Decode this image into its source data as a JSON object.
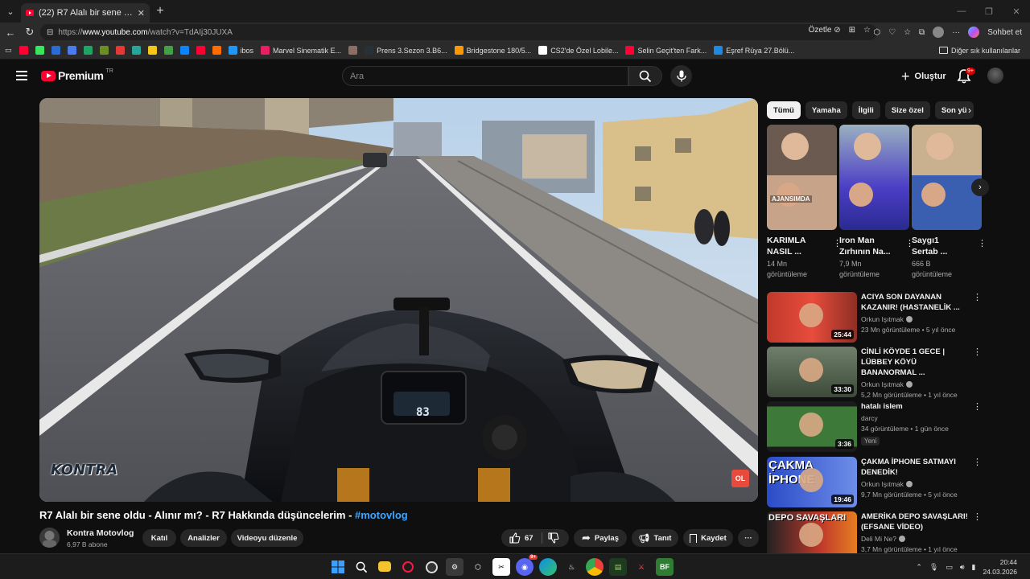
{
  "browser": {
    "tab_title": "(22) R7 Alalı bir sene oldu - Alınır m",
    "url_prefix": "https://",
    "url_host": "www.youtube.com",
    "url_path": "/watch?v=TdAIj30JUXA",
    "summarize_label": "Özetle",
    "chat_label": "Sohbet et"
  },
  "bookmarks": [
    {
      "label": "",
      "color": "#ff0033"
    },
    {
      "label": "",
      "color": "#39e75f"
    },
    {
      "label": "",
      "color": "#2a6bd6"
    },
    {
      "label": "",
      "color": "#4b7bec"
    },
    {
      "label": "",
      "color": "#1fa463"
    },
    {
      "label": "",
      "color": "#6b8e23"
    },
    {
      "label": "",
      "color": "#e53935"
    },
    {
      "label": "",
      "color": "#26a69a"
    },
    {
      "label": "",
      "color": "#f5c518"
    },
    {
      "label": "",
      "color": "#43a047"
    },
    {
      "label": "",
      "color": "#0a84ff"
    },
    {
      "label": "",
      "color": "#ff0033"
    },
    {
      "label": "",
      "color": "#ff6d00"
    },
    {
      "label": "ibos",
      "color": "#2196f3"
    },
    {
      "label": "Marvel Sinematik E...",
      "color": "#e91e63"
    },
    {
      "label": "",
      "color": "#8d6e63"
    },
    {
      "label": "Prens 3.Sezon 3.B6...",
      "color": "#263238"
    },
    {
      "label": "Bridgestone 180/5...",
      "color": "#ff9800"
    },
    {
      "label": "CS2'de Özel Lobile...",
      "color": "#ffffff"
    },
    {
      "label": "Selin Geçit'ten Fark...",
      "color": "#ff0033"
    },
    {
      "label": "Eşref Rüya 27.Bölü...",
      "color": "#1e88e5"
    }
  ],
  "bookmarks_more": "Diğer sık kullanılanlar",
  "youtube": {
    "logo_text": "Premium",
    "logo_region": "TR",
    "search_placeholder": "Ara",
    "create_label": "Oluştur",
    "notif_count": "9+"
  },
  "video": {
    "title": "R7 Alalı bir sene oldu - Alınır mı? - R7 Hakkında düşüncelerim - ",
    "hashtag": "#motovlog",
    "channel_name": "Kontra Motovlog",
    "subscribers": "6,97 B abone",
    "join_label": "Katıl",
    "analytics_label": "Analizler",
    "edit_label": "Videoyu düzenle",
    "likes": "67",
    "share_label": "Paylaş",
    "promote_label": "Tanıt",
    "save_label": "Kaydet",
    "watermark_left": "KONTRA",
    "watermark_right": "OL"
  },
  "chips": [
    "Tümü",
    "Yamaha",
    "İlgili",
    "Size özel",
    "Son yü"
  ],
  "shorts": [
    {
      "title_l1": "KARIMLA",
      "title_l2": "NASIL ...",
      "views_l1": "14 Mn",
      "views_l2": "görüntüleme",
      "overlay": "AJANSIMDA"
    },
    {
      "title_l1": "Iron Man",
      "title_l2": "Zırhının Na...",
      "views_l1": "7,9 Mn",
      "views_l2": "görüntüleme",
      "overlay": ""
    },
    {
      "title_l1": "Saygı1",
      "title_l2": "Sertab ...",
      "views_l1": "666 B",
      "views_l2": "görüntüleme",
      "overlay": ""
    }
  ],
  "recommendations": [
    {
      "title": "ACIYA SON DAYANAN KAZANIR! (HASTANELİK ...",
      "channel": "Orkun Işıtmak",
      "verified": true,
      "meta": "23 Mn görüntüleme • 5 yıl önce",
      "duration": "25:44",
      "badge": ""
    },
    {
      "title": "CİNLİ KÖYDE 1 GECE | LÜBBEY KÖYÜ BANANORMAL ...",
      "channel": "Orkun Işıtmak",
      "verified": true,
      "meta": "5,2 Mn görüntüleme • 1 yıl önce",
      "duration": "33:30",
      "badge": ""
    },
    {
      "title": "hatalı islem",
      "channel": "darcy",
      "verified": false,
      "meta": "34 görüntüleme • 1 gün önce",
      "duration": "3:36",
      "badge": "Yeni"
    },
    {
      "title": "ÇAKMA İPHONE SATMAYI DENEDİK!",
      "channel": "Orkun Işıtmak",
      "verified": true,
      "meta": "9,7 Mn görüntüleme • 5 yıl önce",
      "duration": "19:46",
      "badge": "",
      "thumb_text_1": "ÇAKMA",
      "thumb_text_2": "İPHONE"
    },
    {
      "title": "AMERİKA DEPO SAVAŞLARI! (EFSANE VİDEO)",
      "channel": "Deli Mi Ne?",
      "verified": true,
      "meta": "3,7 Mn görüntüleme • 1 yıl önce",
      "duration": "",
      "badge": "",
      "thumb_text_1": "DEPO SAVAŞLARI",
      "thumb_text_2": ""
    }
  ],
  "taskbar": {
    "time": "20:44",
    "date": "24.03.2026",
    "discord_badge": "9+",
    "bf_label": "BF"
  }
}
